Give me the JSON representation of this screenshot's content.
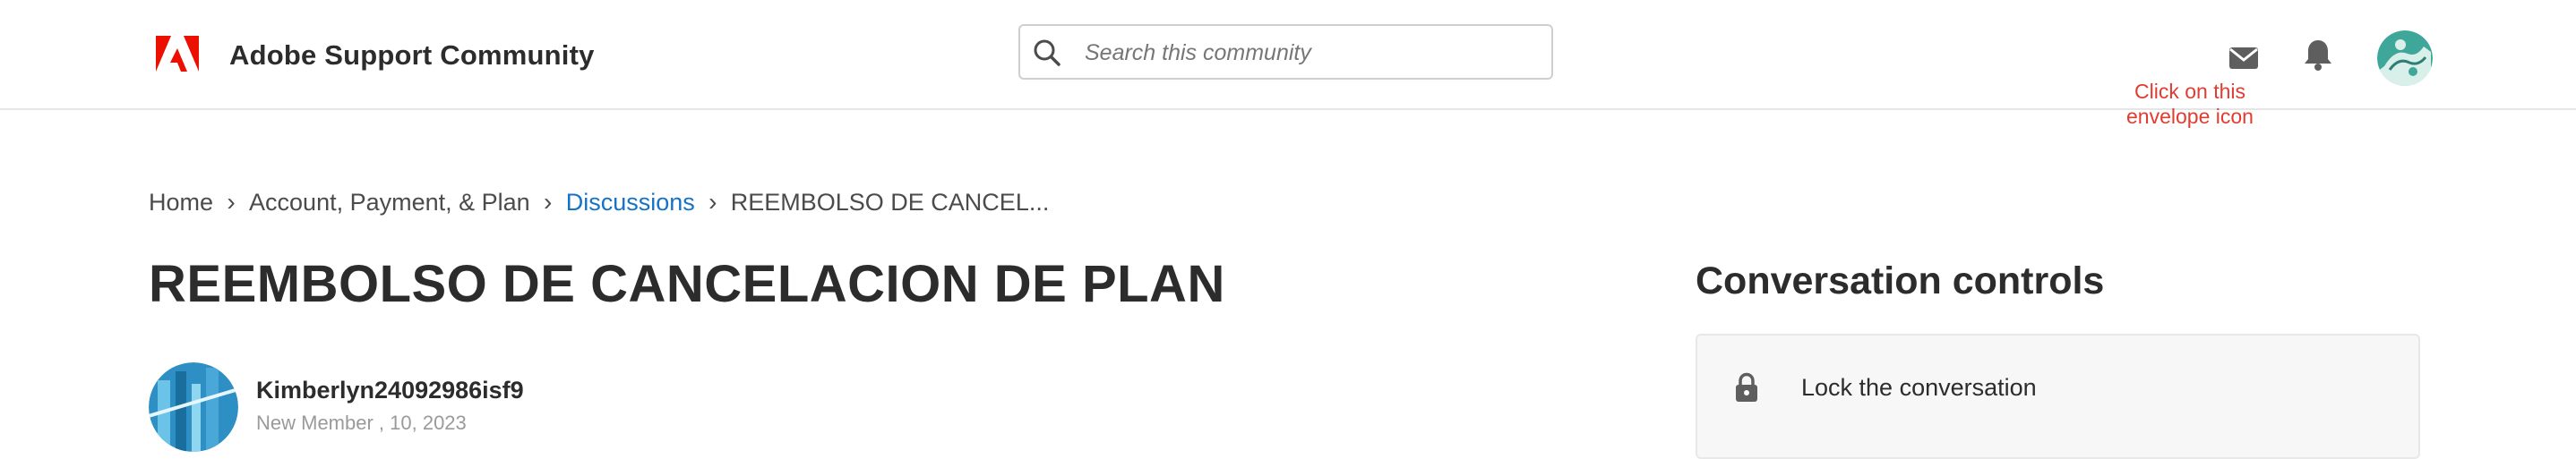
{
  "header": {
    "logo_icon": "adobe-logo-icon",
    "brand": "Adobe Support Community",
    "search": {
      "placeholder": "Search this community",
      "value": ""
    },
    "icons": {
      "messages": "envelope-icon",
      "notifications": "bell-icon",
      "profile": "user-avatar"
    }
  },
  "annotation": {
    "text": "Click on this envelope icon"
  },
  "breadcrumb": {
    "items": [
      {
        "label": "Home"
      },
      {
        "label": "Account, Payment, & Plan"
      },
      {
        "label": "Discussions"
      },
      {
        "label": "REEMBOLSO DE CANCEL..."
      }
    ],
    "separator_icon": "chevron-right-icon"
  },
  "post": {
    "title": "REEMBOLSO DE CANCELACION DE PLAN",
    "author": {
      "name": "Kimberlyn24092986isf9",
      "date_line": "New Member , 10, 2023"
    }
  },
  "sidebar": {
    "title": "Conversation controls",
    "items": [
      {
        "label": "Lock the conversation",
        "icon": "lock-icon"
      }
    ]
  },
  "colors": {
    "brand_red": "#eb1000",
    "link_blue": "#1473c7",
    "annotation_red": "#e03c31",
    "text_dark": "#2c2c2c"
  }
}
